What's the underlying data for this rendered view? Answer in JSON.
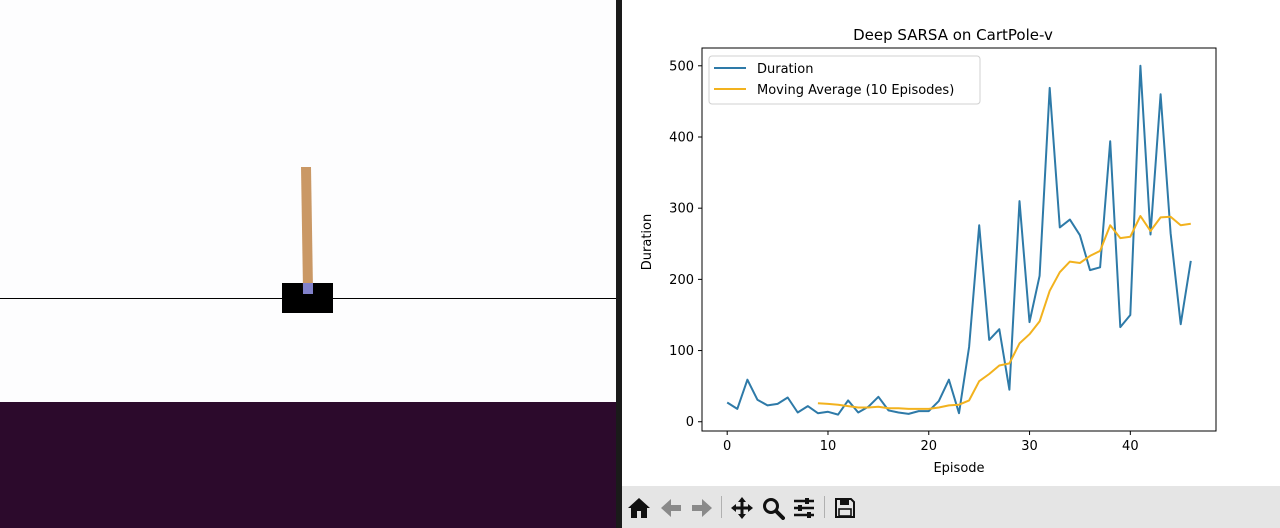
{
  "toolbar": {
    "buttons": [
      {
        "id": "home",
        "icon": "home-icon"
      },
      {
        "id": "back",
        "icon": "arrow-left-icon"
      },
      {
        "id": "forward",
        "icon": "arrow-right-icon"
      },
      {
        "id": "pan",
        "icon": "move-icon"
      },
      {
        "id": "zoom",
        "icon": "magnifier-icon"
      },
      {
        "id": "configure",
        "icon": "sliders-icon"
      },
      {
        "id": "save",
        "icon": "floppy-disk-icon"
      }
    ]
  },
  "colors": {
    "duration": "#2e7aa8",
    "moving_average": "#f2b21e",
    "cart": "#000000",
    "pole": "#ca9865",
    "axle": "#8181ca",
    "desktop": "#2c0a2c"
  },
  "chart_data": {
    "type": "line",
    "title": "Deep SARSA on CartPole-v",
    "xlabel": "Episode",
    "ylabel": "Duration",
    "xlim": [
      -2.5,
      48.5
    ],
    "ylim": [
      -13,
      525
    ],
    "xticks": [
      0,
      10,
      20,
      30,
      40
    ],
    "yticks": [
      0,
      100,
      200,
      300,
      400,
      500
    ],
    "legend_position": "upper-left",
    "series": [
      {
        "name": "Duration",
        "x": [
          0,
          1,
          2,
          3,
          4,
          5,
          6,
          7,
          8,
          9,
          10,
          11,
          12,
          13,
          14,
          15,
          16,
          17,
          18,
          19,
          20,
          21,
          22,
          23,
          24,
          25,
          26,
          27,
          28,
          29,
          30,
          31,
          32,
          33,
          34,
          35,
          36,
          37,
          38,
          39,
          40,
          41,
          42,
          43,
          44,
          45,
          46
        ],
        "values": [
          27,
          18,
          59,
          31,
          23,
          25,
          34,
          13,
          22,
          12,
          14,
          10,
          30,
          13,
          21,
          35,
          16,
          13,
          11,
          15,
          15,
          29,
          59,
          12,
          105,
          276,
          115,
          130,
          45,
          310,
          140,
          205,
          469,
          273,
          284,
          262,
          213,
          217,
          394,
          133,
          150,
          500,
          263,
          460,
          265,
          137,
          226
        ]
      },
      {
        "name": "Moving Average (10 Episodes)",
        "x": [
          9,
          10,
          11,
          12,
          13,
          14,
          15,
          16,
          17,
          18,
          19,
          20,
          21,
          22,
          23,
          24,
          25,
          26,
          27,
          28,
          29,
          30,
          31,
          32,
          33,
          34,
          35,
          36,
          37,
          38,
          39,
          40,
          41,
          42,
          43,
          44,
          45,
          46
        ],
        "values": [
          26,
          25,
          24,
          22,
          20,
          20,
          21,
          19,
          19,
          18,
          18,
          18,
          20,
          23,
          24,
          30,
          57,
          67,
          79,
          82,
          110,
          123,
          141,
          184,
          210,
          225,
          223,
          233,
          240,
          276,
          258,
          260,
          289,
          268,
          287,
          288,
          276,
          278
        ]
      }
    ]
  }
}
